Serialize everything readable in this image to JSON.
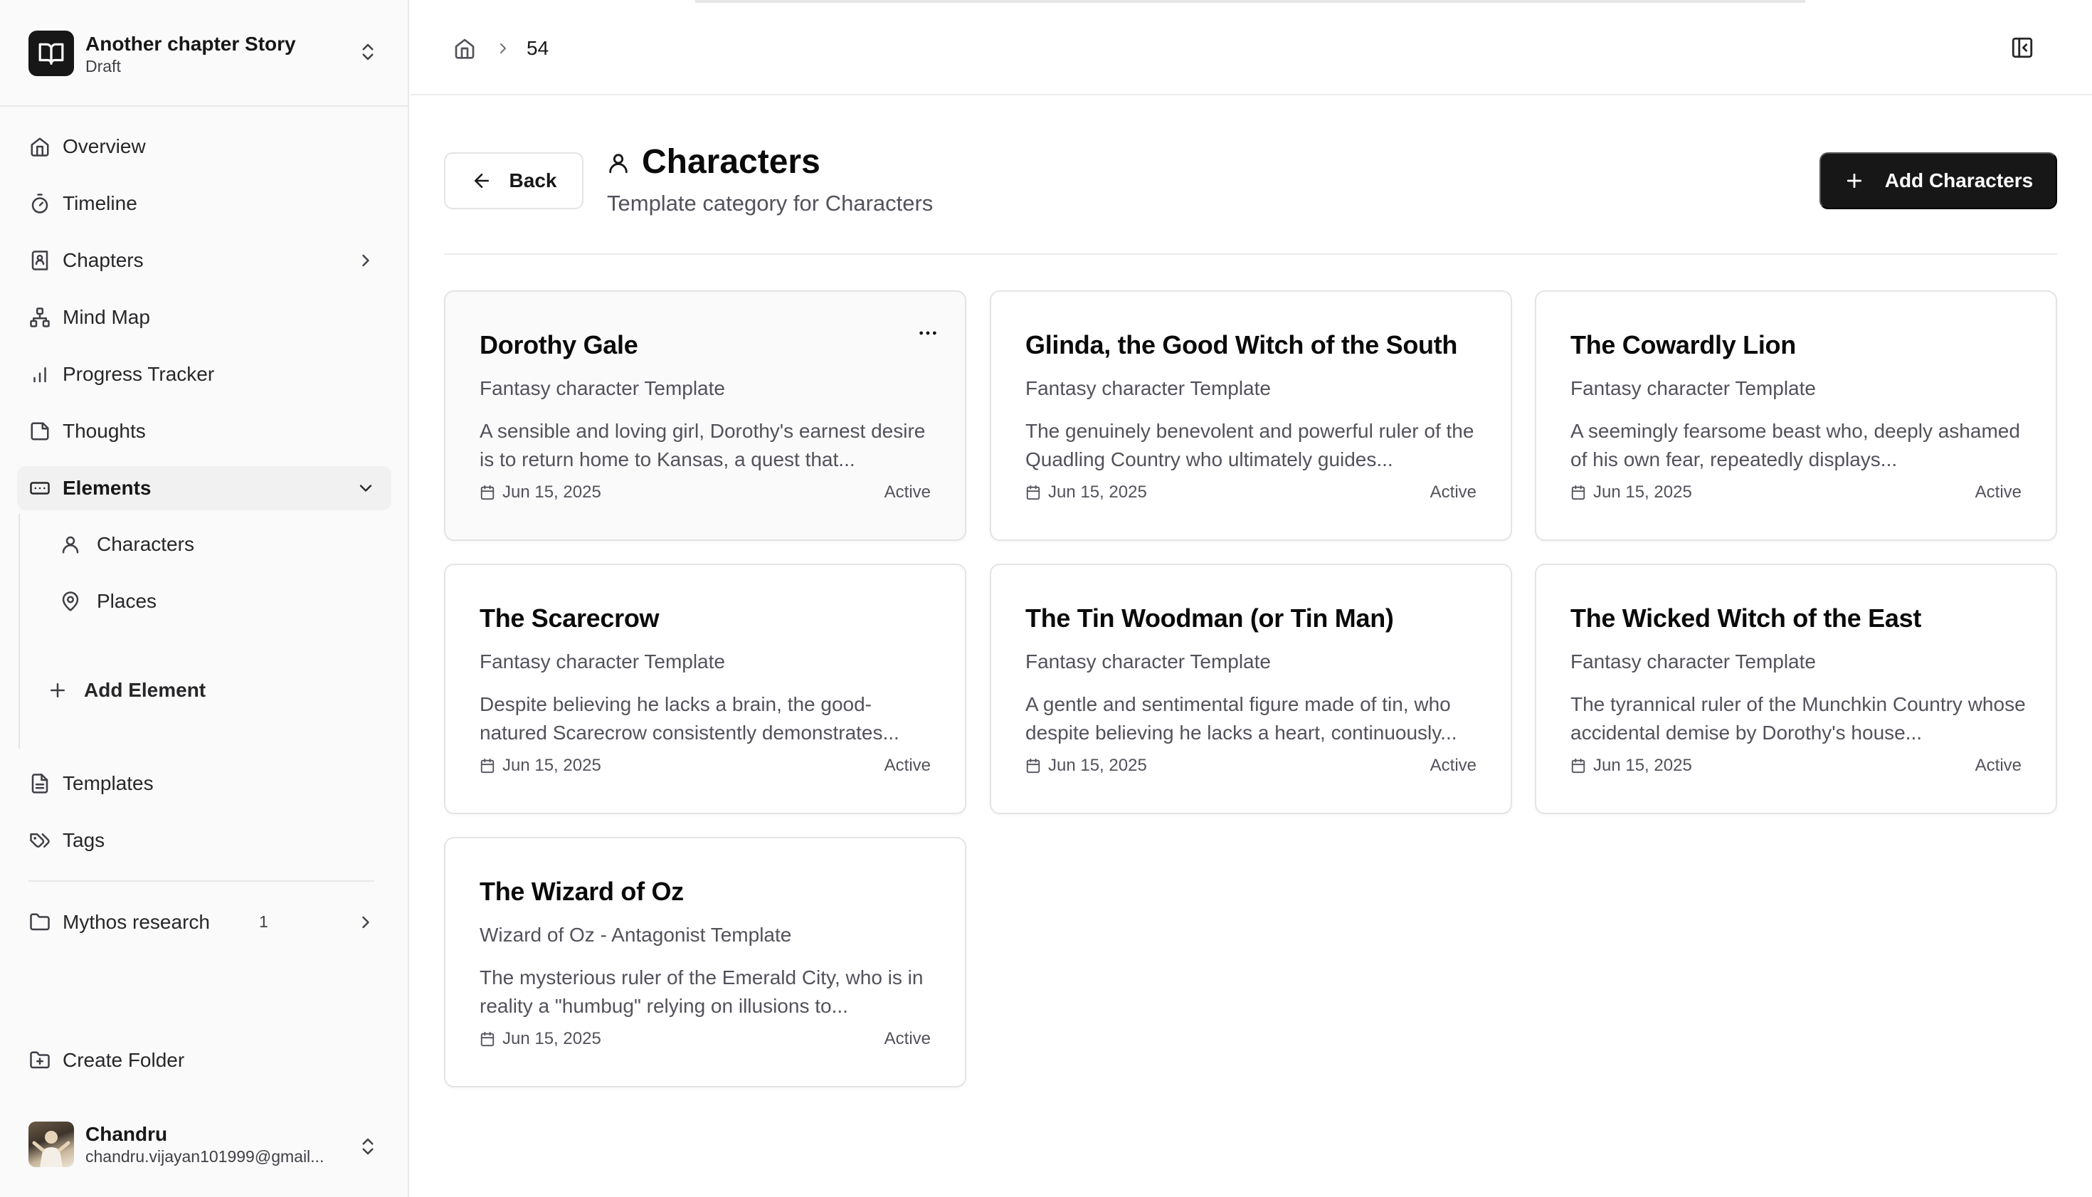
{
  "story": {
    "title": "Another chapter Story",
    "status": "Draft"
  },
  "nav": {
    "overview": "Overview",
    "timeline": "Timeline",
    "chapters": "Chapters",
    "mind_map": "Mind Map",
    "progress_tracker": "Progress Tracker",
    "thoughts": "Thoughts",
    "elements": "Elements",
    "elements_children": [
      "Characters",
      "Places"
    ],
    "add_element": "Add Element",
    "templates": "Templates",
    "tags": "Tags",
    "folder": {
      "label": "Mythos research",
      "count": "1"
    },
    "create_folder": "Create Folder"
  },
  "user": {
    "name": "Chandru",
    "email": "chandru.vijayan101999@gmail..."
  },
  "breadcrumb": {
    "current": "54"
  },
  "header": {
    "back_label": "Back",
    "title": "Characters",
    "subtitle": "Template category for Characters",
    "add_label": "Add Characters"
  },
  "cards": [
    {
      "title": "Dorothy Gale",
      "template": "Fantasy character Template",
      "description": "A sensible and loving girl, Dorothy's earnest desire is to return home to Kansas, a quest that...",
      "date": "Jun 15, 2025",
      "status": "Active"
    },
    {
      "title": "Glinda, the Good Witch of the South",
      "template": "Fantasy character Template",
      "description": "The genuinely benevolent and powerful ruler of the Quadling Country who ultimately guides...",
      "date": "Jun 15, 2025",
      "status": "Active"
    },
    {
      "title": "The Cowardly Lion",
      "template": "Fantasy character Template",
      "description": "A seemingly fearsome beast who, deeply ashamed of his own fear, repeatedly displays...",
      "date": "Jun 15, 2025",
      "status": "Active"
    },
    {
      "title": "The Scarecrow",
      "template": "Fantasy character Template",
      "description": "Despite believing he lacks a brain, the good-natured Scarecrow consistently demonstrates...",
      "date": "Jun 15, 2025",
      "status": "Active"
    },
    {
      "title": "The Tin Woodman (or Tin Man)",
      "template": "Fantasy character Template",
      "description": "A gentle and sentimental figure made of tin, who despite believing he lacks a heart, continuously...",
      "date": "Jun 15, 2025",
      "status": "Active"
    },
    {
      "title": "The Wicked Witch of the East",
      "template": "Fantasy character Template",
      "description": "The tyrannical ruler of the Munchkin Country whose accidental demise by Dorothy's house...",
      "date": "Jun 15, 2025",
      "status": "Active"
    },
    {
      "title": "The Wizard of Oz",
      "template": "Wizard of Oz - Antagonist Template",
      "description": "The mysterious ruler of the Emerald City, who is in reality a \"humbug\" relying on illusions to...",
      "date": "Jun 15, 2025",
      "status": "Active"
    }
  ],
  "icons": {
    "story_logo": "book-open-icon",
    "card_menu": "more-horizontal-icon",
    "card_date": "calendar-icon"
  },
  "colors": {
    "primary": "#171717",
    "sidebar_bg": "#fafafa",
    "active_bg": "#f1f1f2",
    "muted_text": "#52525b",
    "border": "#e4e4e7"
  }
}
